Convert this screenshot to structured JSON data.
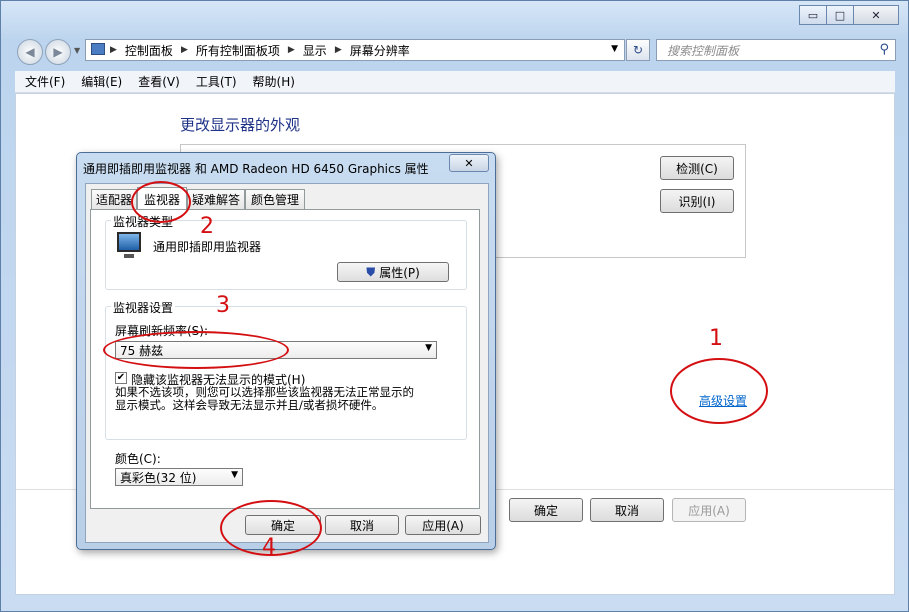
{
  "window": {
    "minimize_glyph": "▭",
    "maximize_glyph": "□",
    "close_glyph": "✕"
  },
  "address_bar": {
    "crumbs": [
      "控制面板",
      "所有控制面板项",
      "显示",
      "屏幕分辨率"
    ],
    "search_placeholder": "搜索控制面板"
  },
  "menu": [
    "文件(F)",
    "编辑(E)",
    "查看(V)",
    "工具(T)",
    "帮助(H)"
  ],
  "main": {
    "heading": "更改显示器的外观",
    "detect_label": "检测(C)",
    "identify_label": "识别(I)",
    "advanced_link": "高级设置",
    "ok_label": "确定",
    "cancel_label": "取消",
    "apply_label": "应用(A)"
  },
  "dialog": {
    "title": "通用即插即用监视器 和 AMD Radeon HD 6450 Graphics 属性",
    "tabs": [
      "适配器",
      "监视器",
      "疑难解答",
      "颜色管理"
    ],
    "active_tab": "监视器",
    "monitor_type_group": "监视器类型",
    "monitor_name": "通用即插即用监视器",
    "properties_label": "属性(P)",
    "settings_group": "监视器设置",
    "refresh_label": "屏幕刷新频率(S):",
    "refresh_value": "75 赫兹",
    "hide_modes_label": "隐藏该监视器无法显示的模式(H)",
    "hide_modes_checked": true,
    "warning_line1": "如果不选该项，则您可以选择那些该监视器无法正常显示的",
    "warning_line2": "显示模式。这样会导致无法显示并且/或者损坏硬件。",
    "color_label": "颜色(C):",
    "color_value": "真彩色(32 位)",
    "ok_label": "确定",
    "cancel_label": "取消",
    "apply_label": "应用(A)"
  },
  "annotations": {
    "step1": "1",
    "step2": "2",
    "step3": "3",
    "step4": "4",
    "color": "#d40f12"
  }
}
